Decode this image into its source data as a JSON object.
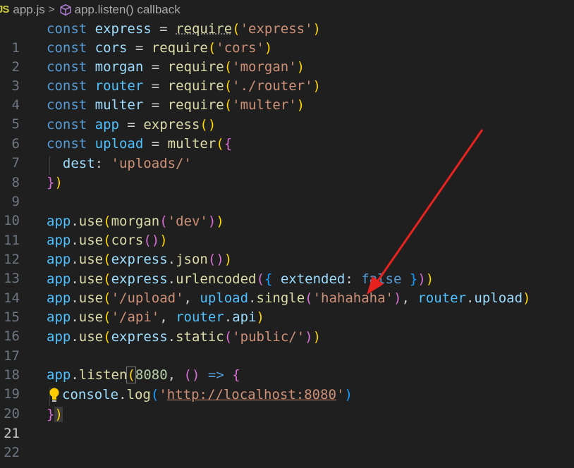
{
  "breadcrumb": {
    "lang_icon": "JS",
    "file": "app.js",
    "sep": ">",
    "symbol_icon": "cube-icon",
    "symbol": "app.listen() callback"
  },
  "lines": [
    {
      "num": "1"
    },
    {
      "num": "2"
    },
    {
      "num": "3"
    },
    {
      "num": "4"
    },
    {
      "num": "5"
    },
    {
      "num": "6"
    },
    {
      "num": "7"
    },
    {
      "num": "8"
    },
    {
      "num": "9"
    },
    {
      "num": "10"
    },
    {
      "num": "11"
    },
    {
      "num": "12"
    },
    {
      "num": "13"
    },
    {
      "num": "14"
    },
    {
      "num": "15"
    },
    {
      "num": "16"
    },
    {
      "num": "17"
    },
    {
      "num": "18"
    },
    {
      "num": "19"
    },
    {
      "num": "20"
    },
    {
      "num": "21"
    },
    {
      "num": "22"
    }
  ],
  "code": {
    "l1": {
      "kw": "const",
      "var": "express",
      "eq": " = ",
      "fn": "require",
      "open": "(",
      "str": "'express'",
      "close": ")"
    },
    "l2": {
      "kw": "const",
      "var": "cors",
      "eq": " = ",
      "fn": "require",
      "open": "(",
      "str": "'cors'",
      "close": ")"
    },
    "l3": {
      "kw": "const",
      "var": "morgan",
      "eq": " = ",
      "fn": "require",
      "open": "(",
      "str": "'morgan'",
      "close": ")"
    },
    "l4": {
      "kw": "const",
      "var": "router",
      "eq": " = ",
      "fn": "require",
      "open": "(",
      "str": "'./router'",
      "close": ")"
    },
    "l5": {
      "kw": "const",
      "var": "multer",
      "eq": " = ",
      "fn": "require",
      "open": "(",
      "str": "'multer'",
      "close": ")"
    },
    "l6": {
      "kw": "const",
      "var": "app",
      "eq": " = ",
      "fn": "express",
      "open": "(",
      "close": ")"
    },
    "l7": {
      "kw": "const",
      "var": "upload",
      "eq": " = ",
      "fn": "multer",
      "open": "(",
      "brace": "{"
    },
    "l8": {
      "prop": "dest",
      "colon": ": ",
      "str": "'uploads/'"
    },
    "l9": {
      "brace": "}",
      "close": ")"
    },
    "l11": {
      "obj": "app",
      "dot": ".",
      "fn": "use",
      "o1": "(",
      "fn2": "morgan",
      "o2": "(",
      "str": "'dev'",
      "c2": ")",
      "c1": ")"
    },
    "l12": {
      "obj": "app",
      "dot": ".",
      "fn": "use",
      "o1": "(",
      "fn2": "cors",
      "o2": "(",
      "c2": ")",
      "c1": ")"
    },
    "l13": {
      "obj": "app",
      "dot": ".",
      "fn": "use",
      "o1": "(",
      "obj2": "express",
      "dot2": ".",
      "fn2": "json",
      "o2": "(",
      "c2": ")",
      "c1": ")"
    },
    "l14": {
      "obj": "app",
      "dot": ".",
      "fn": "use",
      "o1": "(",
      "obj2": "express",
      "dot2": ".",
      "fn2": "urlencoded",
      "o2": "(",
      "o3": "{",
      "prop": " extended",
      "colon": ": ",
      "kw": "false",
      "c3": " }",
      "c2": ")",
      "c1": ")"
    },
    "l15": {
      "obj": "app",
      "dot": ".",
      "fn": "use",
      "o1": "(",
      "str1": "'/upload'",
      "comma": ", ",
      "obj2": "upload",
      "dot2": ".",
      "fn2": "single",
      "o2": "(",
      "str2": "'hahahaha'",
      "c2": ")",
      "comma2": ", ",
      "obj3": "router",
      "dot3": ".",
      "prop3": "upload",
      "c1": ")"
    },
    "l16": {
      "obj": "app",
      "dot": ".",
      "fn": "use",
      "o1": "(",
      "str1": "'/api'",
      "comma": ", ",
      "obj2": "router",
      "dot2": ".",
      "prop2": "api",
      "c1": ")"
    },
    "l17": {
      "obj": "app",
      "dot": ".",
      "fn": "use",
      "o1": "(",
      "obj2": "express",
      "dot2": ".",
      "fn2": "static",
      "o2": "(",
      "str": "'public/'",
      "c2": ")",
      "c1": ")"
    },
    "l19": {
      "obj": "app",
      "dot": ".",
      "fn": "listen",
      "o1": "(",
      "num": "8080",
      "comma": ", ",
      "o2": "(",
      "c2": ")",
      "arrow": " => ",
      "o3": "{"
    },
    "l20": {
      "obj": "console",
      "dot": ".",
      "fn": "log",
      "o1": "(",
      "q1": "'",
      "url": "http://localhost:8080",
      "q2": "'",
      "c1": ")"
    },
    "l21": {
      "c3": "}",
      "c1": ")"
    }
  }
}
